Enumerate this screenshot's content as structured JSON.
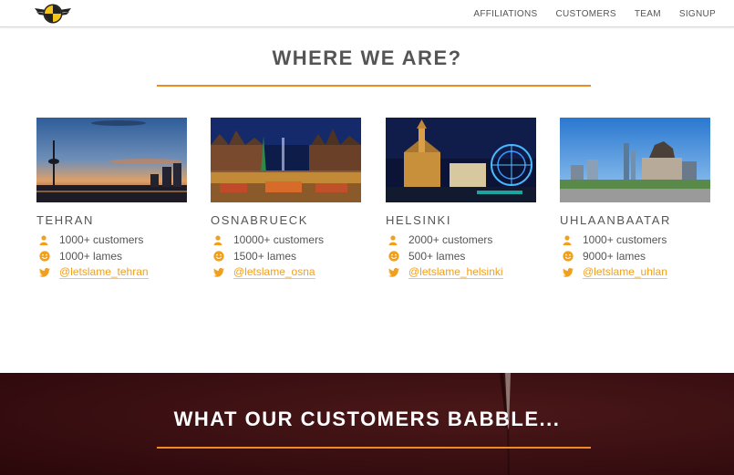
{
  "nav": {
    "items": [
      {
        "label": "AFFILIATIONS"
      },
      {
        "label": "CUSTOMERS"
      },
      {
        "label": "TEAM"
      },
      {
        "label": "SIGNUP"
      }
    ]
  },
  "where": {
    "title": "WHERE WE ARE?"
  },
  "cities": [
    {
      "name": "TEHRAN",
      "customers": "1000+ customers",
      "lames": "1000+ lames",
      "twitter": "@letslame_tehran"
    },
    {
      "name": "OSNABRUECK",
      "customers": "10000+ customers",
      "lames": "1500+ lames",
      "twitter": "@letslame_osna"
    },
    {
      "name": "HELSINKI",
      "customers": "2000+ customers",
      "lames": "500+ lames",
      "twitter": "@letslame_helsinki"
    },
    {
      "name": "UHLAANBAATAR",
      "customers": "1000+ customers",
      "lames": "9000+ lames",
      "twitter": "@letslame_uhlan"
    }
  ],
  "babble": {
    "title": "WHAT OUR CUSTOMERS BABBLE..."
  },
  "icons": {
    "logo": "winged-emblem-logo",
    "customers": "user-icon",
    "lames": "smiley-icon",
    "twitter": "twitter-icon"
  },
  "colors": {
    "accent": "#f08a24",
    "link": "#f0a01e",
    "text": "#555555",
    "dark_section": "#3a0f12"
  }
}
